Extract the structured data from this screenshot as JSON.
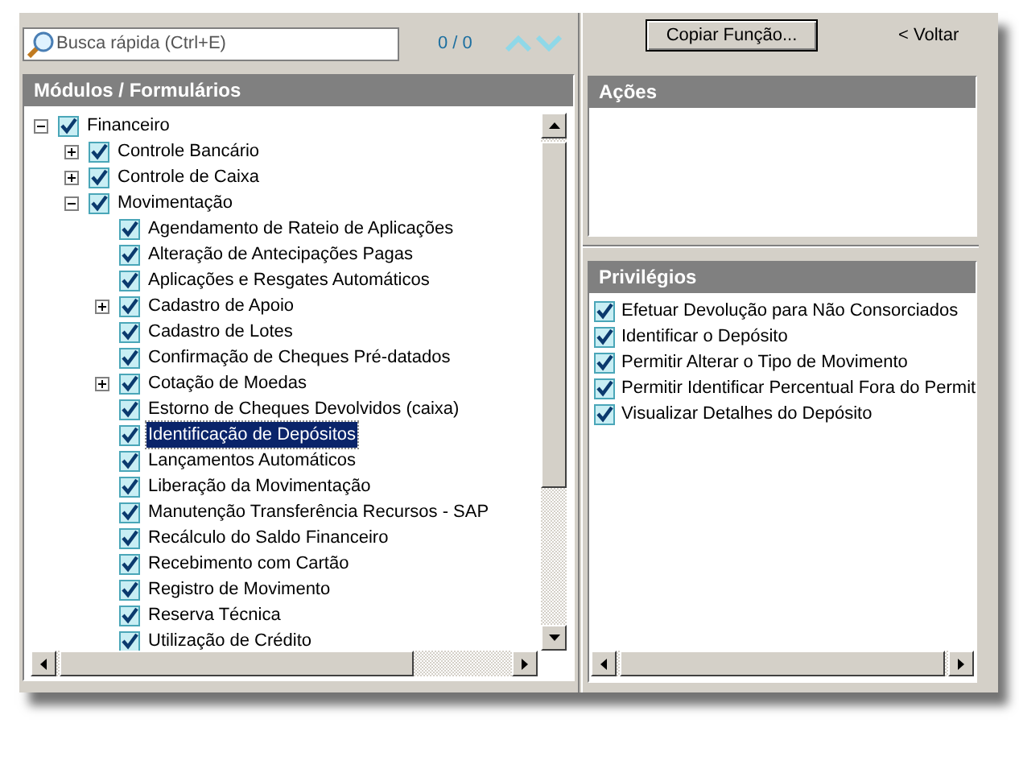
{
  "search": {
    "placeholder": "Busca rápida (Ctrl+E)",
    "count": "0 / 0"
  },
  "toolbar": {
    "copy_button": "Copiar Função...",
    "back_link": "< Voltar"
  },
  "modules": {
    "title": "Módulos / Formulários",
    "tree": [
      {
        "label": "Financeiro",
        "checked": true,
        "selected": false,
        "expanded": true,
        "children": [
          {
            "label": "Controle Bancário",
            "checked": true,
            "selected": false,
            "expanded": false
          },
          {
            "label": "Controle de Caixa",
            "checked": true,
            "selected": false,
            "expanded": false
          },
          {
            "label": "Movimentação",
            "checked": true,
            "selected": false,
            "expanded": true,
            "children": [
              {
                "label": "Agendamento de Rateio de Aplicações",
                "checked": true,
                "selected": false
              },
              {
                "label": "Alteração de Antecipações Pagas",
                "checked": true,
                "selected": false
              },
              {
                "label": "Aplicações e Resgates Automáticos",
                "checked": true,
                "selected": false
              },
              {
                "label": "Cadastro de Apoio",
                "checked": true,
                "selected": false,
                "expanded": false
              },
              {
                "label": "Cadastro de Lotes",
                "checked": true,
                "selected": false
              },
              {
                "label": "Confirmação de Cheques Pré-datados",
                "checked": true,
                "selected": false
              },
              {
                "label": "Cotação de Moedas",
                "checked": true,
                "selected": false,
                "expanded": false
              },
              {
                "label": "Estorno de Cheques Devolvidos (caixa)",
                "checked": true,
                "selected": false
              },
              {
                "label": "Identificação de Depósitos",
                "checked": true,
                "selected": true
              },
              {
                "label": "Lançamentos Automáticos",
                "checked": true,
                "selected": false
              },
              {
                "label": "Liberação da Movimentação",
                "checked": true,
                "selected": false
              },
              {
                "label": "Manutenção Transferência Recursos - SAP",
                "checked": true,
                "selected": false
              },
              {
                "label": "Recálculo do Saldo Financeiro",
                "checked": true,
                "selected": false
              },
              {
                "label": "Recebimento com Cartão",
                "checked": true,
                "selected": false
              },
              {
                "label": "Registro de Movimento",
                "checked": true,
                "selected": false
              },
              {
                "label": "Reserva Técnica",
                "checked": true,
                "selected": false
              },
              {
                "label": "Utilização de Crédito",
                "checked": true,
                "selected": false
              }
            ]
          }
        ]
      }
    ]
  },
  "actions": {
    "title": "Ações"
  },
  "privileges": {
    "title": "Privilégios",
    "items": [
      {
        "label": "Efetuar Devolução para Não Consorciados",
        "checked": true
      },
      {
        "label": "Identificar o Depósito",
        "checked": true
      },
      {
        "label": "Permitir Alterar o Tipo de Movimento",
        "checked": true
      },
      {
        "label": "Permitir Identificar Percentual Fora do Permit",
        "checked": true
      },
      {
        "label": "Visualizar Detalhes do Depósito",
        "checked": true
      }
    ]
  }
}
